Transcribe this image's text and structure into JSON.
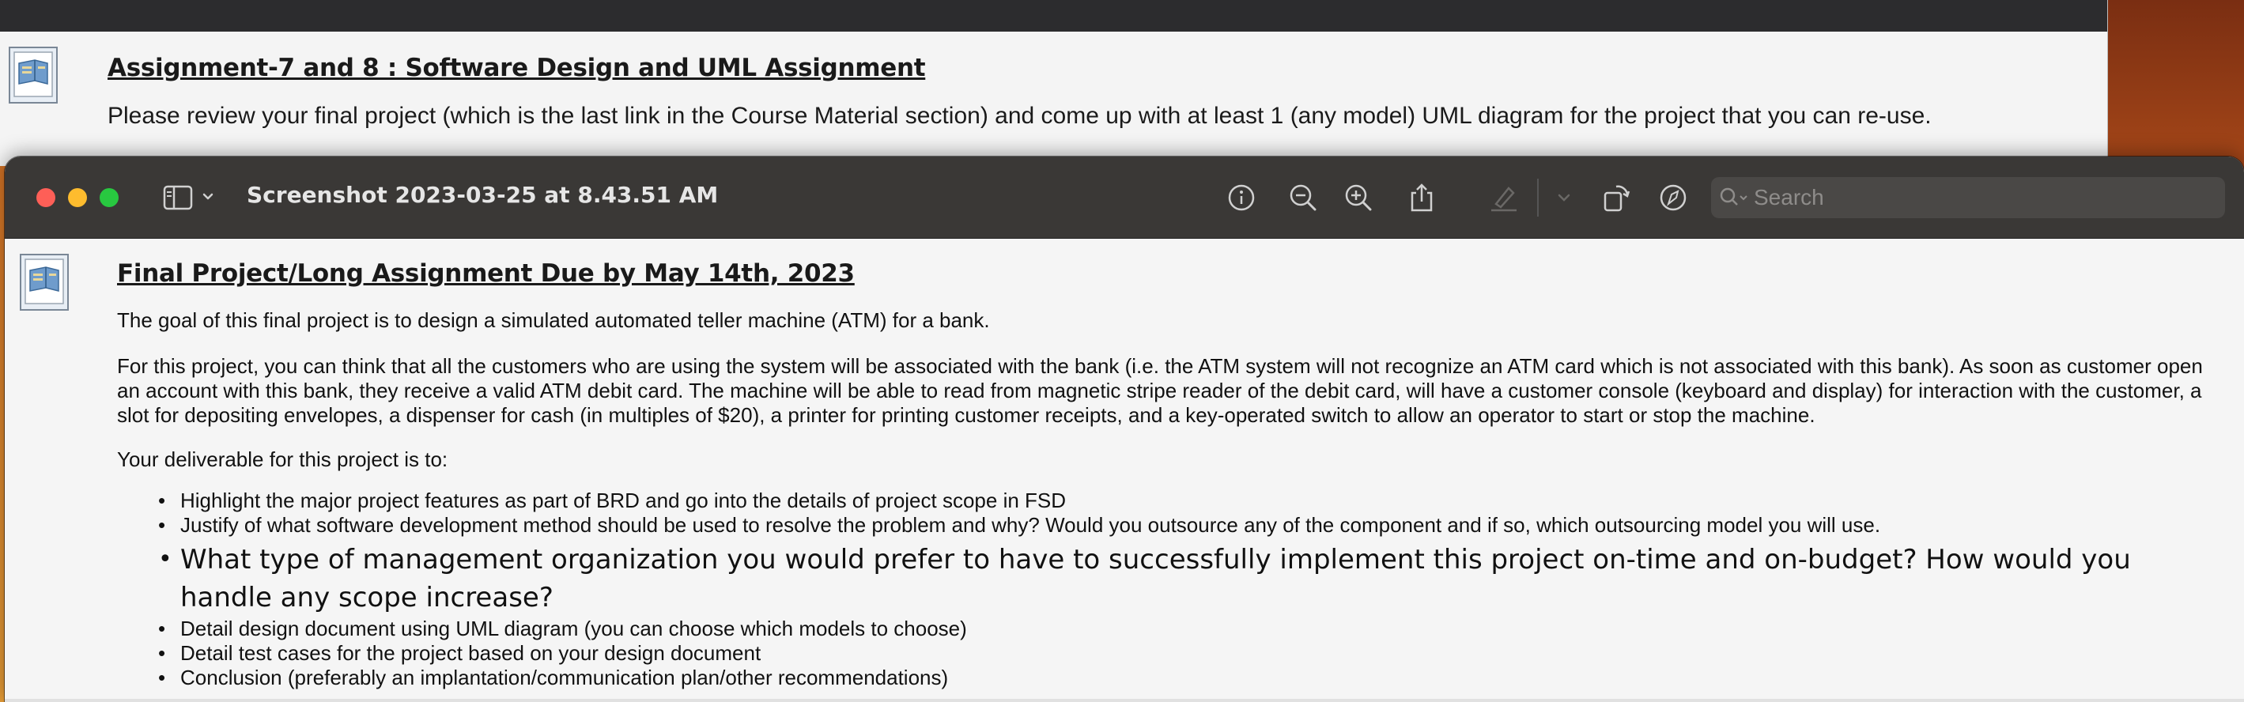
{
  "background_window": {
    "title": "Assignment-7 and 8 : Software Design and UML Assignment",
    "description": "Please review your final project (which is the last link in the Course Material section)  and come up with at least 1 (any model) UML diagram for the project that you can re-use."
  },
  "preview_window": {
    "title": "Screenshot 2023-03-25 at 8.43.51 AM",
    "search": {
      "placeholder": "Search",
      "value": ""
    },
    "toolbar_icons": [
      "info-icon",
      "zoom-out-icon",
      "zoom-in-icon",
      "share-icon",
      "highlight-icon",
      "chevron-down-icon",
      "rotate-icon",
      "markup-icon",
      "search-icon"
    ]
  },
  "document": {
    "title": "Final Project/Long Assignment Due by May 14th, 2023",
    "goal": "The goal of this final project is to design a simulated automated teller machine (ATM) for a bank.",
    "body": "For this project, you can think that all the customers who are using the system will be associated with the bank (i.e. the ATM system will not recognize an ATM card which is not associated with this bank). As soon as customer open an account with this bank, they receive a valid ATM debit card. The machine will be able to read from magnetic stripe reader of the debit card, will have a customer console (keyboard and display) for interaction with the customer, a slot for depositing envelopes, a dispenser for cash (in multiples of $20), a printer for printing customer receipts, and a key-operated switch to allow an operator to start or stop the machine.",
    "deliverable_intro": "Your deliverable for this project is to:",
    "deliverables": [
      "Highlight the major project features as part of BRD and go into the details of project scope in FSD",
      "Justify of what software development method should be used to resolve the problem and why? Would you outsource any of the component and if so, which outsourcing model you will use.",
      "What type of management organization you would prefer to have to successfully implement this project on-time and on-budget? How would you handle any scope increase?",
      "Detail design document using UML diagram (you can choose which models to choose)",
      "Detail test cases for the project based on your design document",
      "Conclusion (preferably an implantation/communication plan/other recommendations)"
    ]
  },
  "colors": {
    "titlebar": "#3a3836",
    "close": "#fe5f57",
    "minimize": "#febc2e",
    "maximize": "#28c840",
    "desktop": "#c8621e"
  }
}
